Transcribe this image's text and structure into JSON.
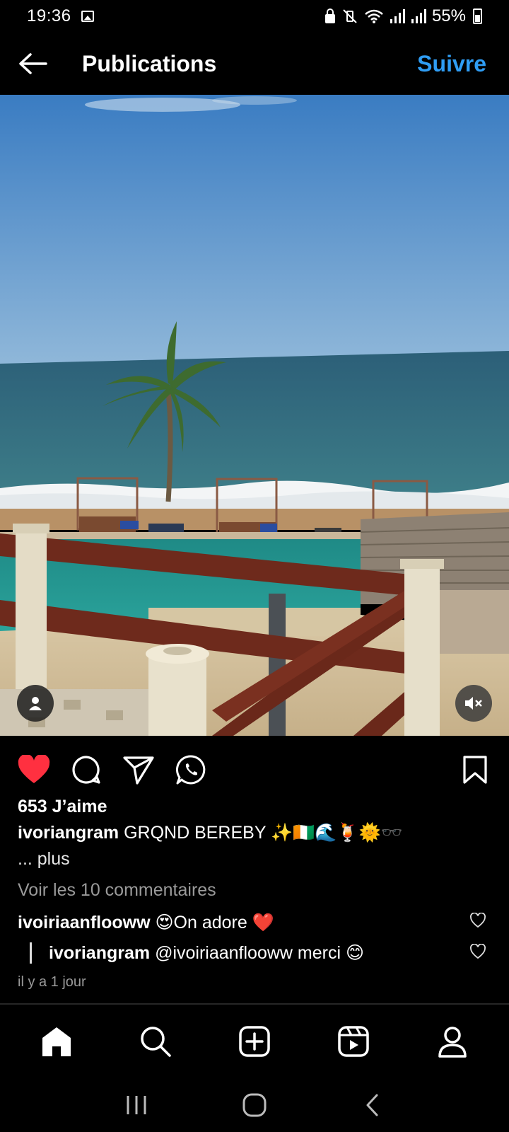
{
  "status_bar": {
    "time": "19:36",
    "battery": "55%"
  },
  "header": {
    "title": "Publications",
    "follow_label": "Suivre"
  },
  "post": {
    "likes_text": "653 J’aime",
    "caption": {
      "username": "ivoriangram",
      "text": "GRQND BEREBY ✨🇨🇮🌊🍹🌞🕶️"
    },
    "more_label": "... plus",
    "view_comments_label": "Voir les 10 commentaires",
    "comments": [
      {
        "username": "ivoiriaanflooww",
        "text": "😍On adore ❤️"
      },
      {
        "username": "ivoriangram",
        "text": "@ivoiriaanflooww merci 😊"
      }
    ],
    "time_ago": "il y a 1 jour"
  },
  "colors": {
    "accent": "#2f9df4",
    "like_red": "#ff3040",
    "secondary_text": "#9a9a9a"
  },
  "icons": {
    "back": "arrow-left-icon",
    "like": "heart-filled-icon",
    "comment": "comment-icon",
    "share": "send-icon",
    "whatsapp": "whatsapp-icon",
    "save": "bookmark-icon",
    "tag": "user-tag-icon",
    "mute": "volume-muted-icon",
    "nav": [
      "home-icon",
      "search-icon",
      "create-icon",
      "reels-icon",
      "profile-icon"
    ],
    "system": [
      "recents-icon",
      "home-circle-icon",
      "back-chevron-icon"
    ]
  }
}
